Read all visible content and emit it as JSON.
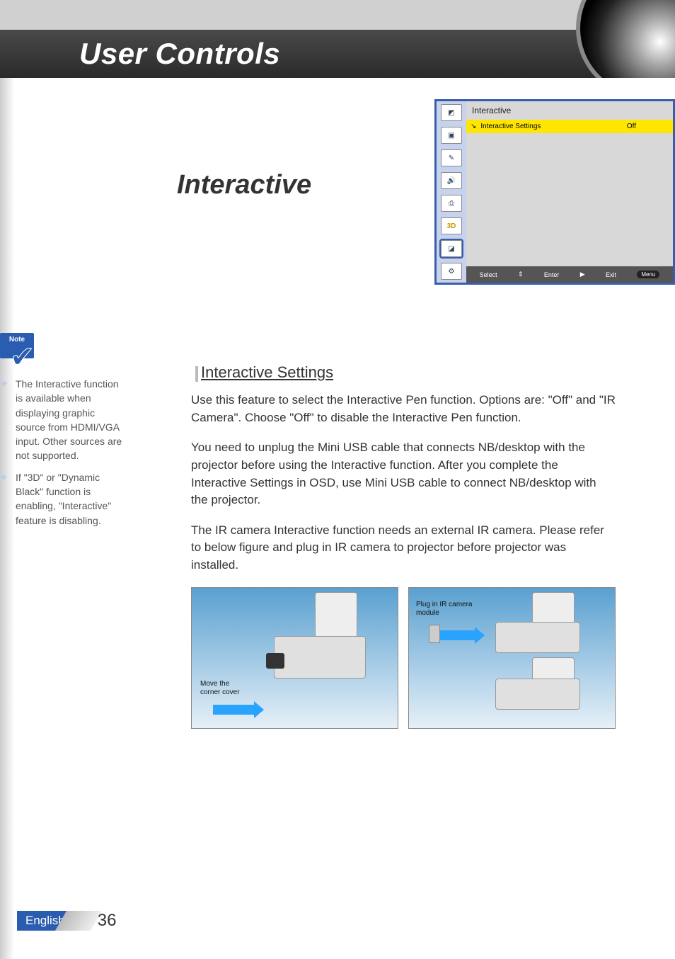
{
  "header": {
    "title": "User Controls"
  },
  "section": {
    "title": "Interactive"
  },
  "osd": {
    "category": "Interactive",
    "row_label": "Interactive Settings",
    "row_value": "Off",
    "footer": {
      "select": "Select",
      "enter": "Enter",
      "exit": "Exit",
      "menu": "Menu"
    },
    "side_icons": [
      "◩",
      "▣",
      "✎",
      "🔊",
      "⎙",
      "3D",
      "◪",
      "⚙"
    ],
    "active_index": 6
  },
  "note": {
    "label": "Note",
    "items": [
      "The Interactive function is available when displaying graphic source from HDMI/VGA input. Other sources are not supported.",
      "If \"3D\" or \"Dynamic Black\" function is enabling, \"Interactive\" feature is disabling."
    ]
  },
  "body": {
    "sub_heading": "Interactive Settings",
    "p1": "Use this feature to select the Interactive Pen function. Options are: \"Off\" and \"IR Camera\". Choose \"Off\" to disable the Interactive Pen function.",
    "p2": "You need to unplug the Mini USB cable that connects NB/desktop with the projector before using the Interactive function. After you complete the Interactive Settings in OSD, use Mini USB cable to connect NB/desktop with the projector.",
    "p3": "The IR camera Interactive function needs an external IR camera. Please refer to below figure and plug in IR camera to projector before projector was installed."
  },
  "figure": {
    "left_caption": "Move the corner cover",
    "right_caption": "Plug in IR camera module"
  },
  "footer": {
    "language": "English",
    "page": "36"
  }
}
